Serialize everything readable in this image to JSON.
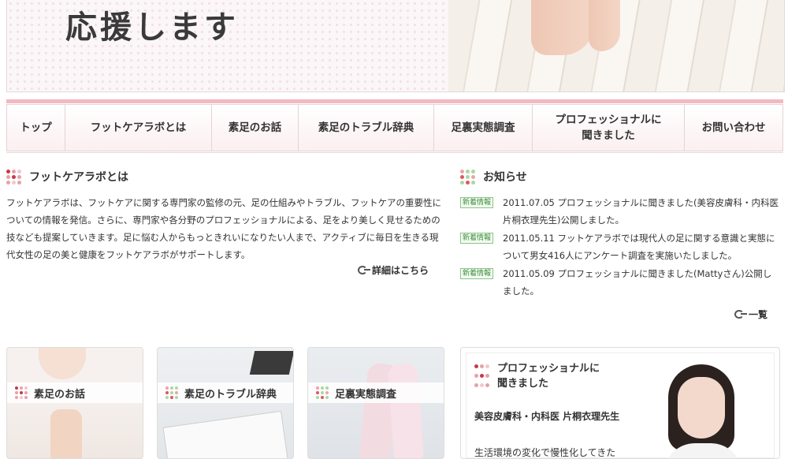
{
  "hero": {
    "title": "応援します"
  },
  "nav": {
    "items": [
      {
        "label": "トップ"
      },
      {
        "label": "フットケアラボとは"
      },
      {
        "label": "素足のお話"
      },
      {
        "label": "素足のトラブル辞典"
      },
      {
        "label": "足裏実態調査"
      },
      {
        "label": "プロフェッショナルに\n聞きました"
      },
      {
        "label": "お問い合わせ"
      }
    ]
  },
  "about": {
    "heading": "フットケアラボとは",
    "text": "フットケアラボは、フットケアに関する専門家の監修の元、足の仕組みやトラブル、フットケアの重要性についての情報を発信。さらに、専門家や各分野のプロフェッショナルによる、足をより美しく見せるための技なども提案していきます。足に悩む人からもっときれいになりたい人まで、アクティブに毎日を生きる現代女性の足の美と健康をフットケアラボがサポートします。",
    "more_label": "詳細はこちら"
  },
  "news": {
    "heading": "お知らせ",
    "items": [
      {
        "badge": "新着情報",
        "text": "2011.07.05 プロフェッショナルに聞きました(美容皮膚科・内科医 片桐衣理先生)公開しました。"
      },
      {
        "badge": "新着情報",
        "text": "2011.05.11 フットケアラボでは現代人の足に関する意識と実態について男女416人にアンケート調査を実施いたしました。"
      },
      {
        "badge": "新着情報",
        "text": "2011.05.09 プロフェッショナルに聞きました(Mattyさん)公開しました。"
      }
    ],
    "list_label": "一覧"
  },
  "cards": [
    {
      "label": "素足のお話"
    },
    {
      "label": "素足のトラブル辞典"
    },
    {
      "label": "足裏実態調査"
    }
  ],
  "pro": {
    "heading": "プロフェッショナルに\n聞きました",
    "name": "美容皮膚科・内科医 片桐衣理先生",
    "desc": "生活環境の変化で慢性化してきた女"
  }
}
